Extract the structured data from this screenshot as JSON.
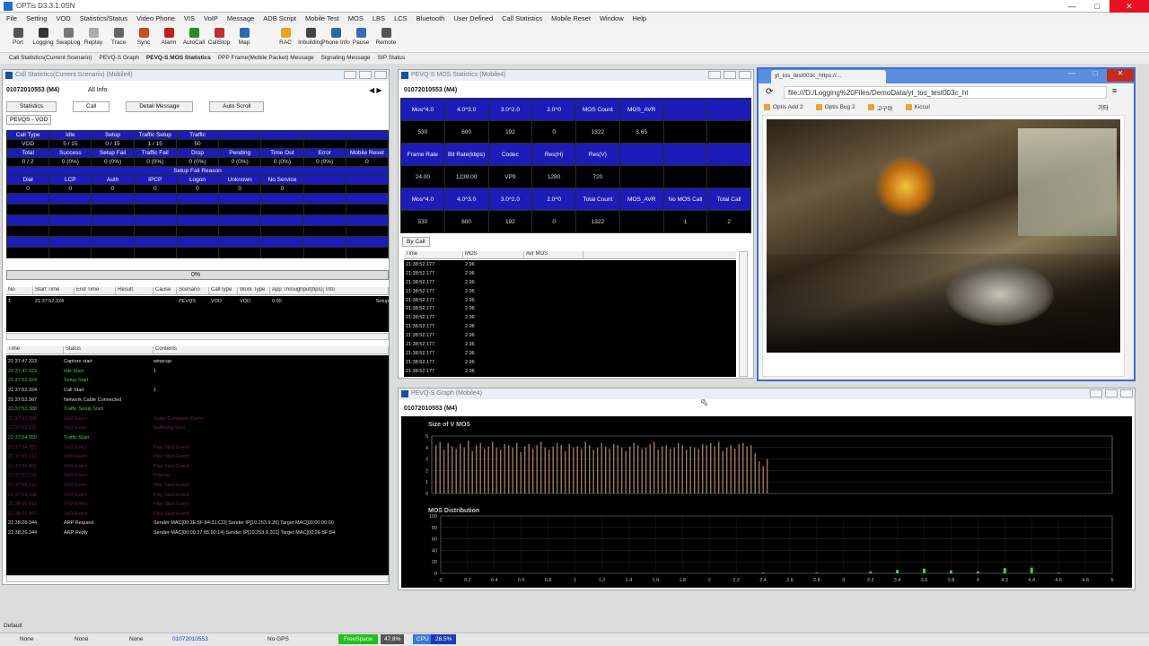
{
  "app": {
    "title": "OPTis D3.3.1.0SN"
  },
  "menu": [
    "File",
    "Setting",
    "VOD",
    "Statistics/Status",
    "Video Phone",
    "VIS",
    "VoIP",
    "Message",
    "ADB Script",
    "Mobile Test",
    "MOS",
    "LBS",
    "LCS",
    "Bluetooth",
    "User Defined",
    "Call Statistics",
    "Mobile Reset",
    "Window",
    "Help"
  ],
  "toolbar": [
    "Port",
    "Logging",
    "SwapLog",
    "Replay",
    "Trace",
    "Sync",
    "Alarm",
    "AutoCall",
    "CallStop",
    "Map",
    "RAC",
    "Inbuilding",
    "Phone Info",
    "Pause",
    "Remote"
  ],
  "tabs": [
    "Call Statistics(Current Scenario)",
    "PEVQ-S Graph",
    "PEVQ-S MOS Statistics",
    "PPP Frame(Mobile Packet) Message",
    "Signaling Message",
    "SIP Status"
  ],
  "call_stats": {
    "title": "Call Statistics(Current Scenario) (Mobile4)",
    "device": "01072010553 (M4)",
    "all_info": "All Info",
    "subtabs": [
      "Statistics",
      "Call",
      "Detail Message",
      "Auto Scroll"
    ],
    "pevq_tab": "PEVQS - VOD",
    "row1_hdr": [
      "Call Type",
      "Idle",
      "Setup",
      "Traffic Setup",
      "Traffic"
    ],
    "row1_val": [
      "VOD",
      "5 / 15",
      "0 / 15",
      "1 / 15",
      "50"
    ],
    "row2_hdr": [
      "Total",
      "Success",
      "Setup Fail",
      "Traffic Fail",
      "Drop",
      "Pending",
      "Time Out",
      "Error",
      "Mobile Reset"
    ],
    "row2_val": [
      "0 / 2",
      "0 (0%)",
      "0 (0%)",
      "0 (0%)",
      "0 (0%)",
      "0 (0%)",
      "0 (0%)",
      "0 (0%)",
      "0"
    ],
    "fail_title": "Setup Fail Reason",
    "row3_hdr": [
      "Dial",
      "LCP",
      "Auth",
      "IPCP",
      "Logon",
      "Unknown",
      "No Service"
    ],
    "row3_val": [
      "0",
      "0",
      "0",
      "0",
      "0",
      "0",
      "0"
    ],
    "progress": "0%",
    "list_cols": [
      "No",
      "Start Time",
      "End Time",
      "Result",
      "Cause",
      "Scenario",
      "CallType",
      "Work Type",
      "App Throughput(bps)",
      "Info"
    ],
    "list_row": [
      "1",
      "21:37:52.324",
      "",
      "",
      "",
      "PEVQS",
      "VOD",
      "VOD",
      "0.00",
      "",
      "Setup"
    ],
    "log_cols": [
      "Time",
      "Status",
      "Contents"
    ],
    "log": [
      {
        "t": "21:37:47.323",
        "s": "Capture start",
        "c": "winpcap",
        "k": "wh"
      },
      {
        "t": "21:37:47.323",
        "s": "Idle Start",
        "c": "1",
        "k": "gl"
      },
      {
        "t": "21:37:52.324",
        "s": "Setup Start",
        "c": "",
        "k": "gl"
      },
      {
        "t": "21:37:52.324",
        "s": "Call Start",
        "c": "1",
        "k": "wh"
      },
      {
        "t": "21:37:52.367",
        "s": "Network Cable Connected",
        "c": "",
        "k": "wh"
      },
      {
        "t": "21:37:52.388",
        "s": "Traffic Setup Start",
        "c": "",
        "k": "gl"
      },
      {
        "t": "21:37:52.398",
        "s": "VoD Event",
        "c": "Setup Complete Event",
        "k": "pk"
      },
      {
        "t": "21:37:53.115",
        "s": "VoD Event",
        "c": "Buffering Start",
        "k": "pk"
      },
      {
        "t": "21:37:54.050",
        "s": "Traffic Start",
        "c": "",
        "k": "gl"
      },
      {
        "t": "21:37:54.051",
        "s": "VoD Event",
        "c": "Play Start Event",
        "k": "pk"
      },
      {
        "t": "21:37:55.211",
        "s": "VoD Event",
        "c": "Play Start Event",
        "k": "pk"
      },
      {
        "t": "21:37:56.002",
        "s": "VoD Event",
        "c": "Play Start Event",
        "k": "pk"
      },
      {
        "t": "21:37:57.118",
        "s": "VoD Event",
        "c": "Playing",
        "k": "pk"
      },
      {
        "t": "21:37:58.221",
        "s": "VoD Event",
        "c": "Play Start Event",
        "k": "pk"
      },
      {
        "t": "21:37:59.338",
        "s": "VoD Event",
        "c": "Play Start Event",
        "k": "pk"
      },
      {
        "t": "21:38:00.412",
        "s": "VoD Event",
        "c": "Play Start Event",
        "k": "pk"
      },
      {
        "t": "21:38:01.507",
        "s": "VoD Event",
        "c": "Play Start Event",
        "k": "pk"
      },
      {
        "t": "21:38:26.344",
        "s": "ARP Request",
        "c": "Sender MAC[00:2E:5F:84:31:CD] Sender IP[10.253.9.26] Target MAC[00:00:00:00",
        "k": "wh"
      },
      {
        "t": "21:38:26.344",
        "s": "ARP Reply",
        "c": "Sender MAC[00:00:37:85:90:14] Sender IP[10.253.9.201] Target MAC[00:2E:5F:84",
        "k": "wh"
      }
    ]
  },
  "mos_stats": {
    "title": "PEVQ-S MOS Statistics (Mobile4)",
    "device": "01072010553 (M4)",
    "r1h": [
      "Mos^4.0",
      "4.0^3.0",
      "3.0^2.0",
      "2.0^0",
      "MOS Count",
      "MOS_AVR",
      "",
      ""
    ],
    "r1v": [
      "530",
      "600",
      "192",
      "0",
      "1322",
      "3.65",
      "",
      ""
    ],
    "r2h": [
      "Frame Rate",
      "Bit Rate(kbps)",
      "Codec",
      "Res(H)",
      "Res(V)",
      "",
      "",
      ""
    ],
    "r2v": [
      "24.00",
      "1239.00",
      "VP9",
      "1280",
      "720",
      "",
      "",
      ""
    ],
    "r3h": [
      "Mos^4.0",
      "4.0^3.0",
      "3.0^2.0",
      "2.0^0",
      "Total Count",
      "MOS_AVR",
      "No MOS Call",
      "Total Call"
    ],
    "r3v": [
      "530",
      "600",
      "192",
      "0",
      "1322",
      "",
      "1",
      "2"
    ],
    "bycall": "By Call",
    "cols": [
      "Time",
      "MOS",
      "Avr MOS"
    ],
    "rows": [
      [
        "21:38:52.177",
        "2.96"
      ],
      [
        "21:38:52.177",
        "2.96"
      ],
      [
        "21:38:52.177",
        "2.96"
      ],
      [
        "21:38:52.177",
        "2.96"
      ],
      [
        "21:38:52.177",
        "2.96"
      ],
      [
        "21:38:52.177",
        "2.96"
      ],
      [
        "21:38:52.177",
        "2.96"
      ],
      [
        "21:38:52.177",
        "2.96"
      ],
      [
        "21:38:52.177",
        "2.96"
      ],
      [
        "21:38:52.177",
        "2.96"
      ],
      [
        "21:38:52.177",
        "2.96"
      ],
      [
        "21:38:52.177",
        "2.96"
      ],
      [
        "21:38:52.177",
        "2.96"
      ]
    ]
  },
  "browser": {
    "tab": "yt_tos_test003c_https://...",
    "url": "file:///D:/Logging%20Files/DemoData/yt_tos_test003c_ht",
    "bookmarks": [
      "Optis Add 2",
      "Optis Bug 2",
      "고구마",
      "Kiccul"
    ],
    "other": "기타"
  },
  "graph": {
    "title": "PEVQ-S Graph (Mobile4)",
    "device": "01072010553 (M4)",
    "chart_data": [
      {
        "type": "bar",
        "title": "Size of V MOS",
        "ylim": [
          0,
          5
        ],
        "yticks": [
          "0",
          "1",
          "2",
          "3",
          "4",
          "5"
        ],
        "color": "#9b7a5a",
        "values": [
          4.2,
          4.5,
          3.8,
          4.4,
          4.1,
          3.9,
          4.3,
          4.0,
          4.6,
          3.7,
          4.2,
          4.4,
          3.9,
          4.1,
          4.5,
          4.0,
          3.8,
          4.3,
          4.2,
          4.0,
          4.4,
          3.6,
          4.1,
          4.3,
          3.9,
          4.2,
          4.5,
          4.0,
          3.8,
          4.1,
          4.4,
          4.2,
          3.7,
          4.3,
          4.0,
          4.1,
          3.9,
          4.5,
          4.2,
          3.8,
          4.0,
          4.4,
          4.1,
          3.9,
          4.3,
          4.2,
          4.0,
          3.7,
          4.1,
          4.4,
          4.2,
          3.9,
          4.0,
          4.3,
          4.5,
          3.8,
          4.1,
          4.2,
          3.9,
          4.0,
          4.4,
          4.2,
          3.8,
          4.1,
          4.0,
          3.9,
          4.3,
          4.2,
          4.4,
          4.1,
          4.5,
          3.7,
          4.0,
          4.2,
          3.9,
          4.3,
          4.4,
          4.1,
          4.2,
          3.5,
          2.8,
          2.4,
          3.0
        ]
      },
      {
        "type": "bar",
        "title": "MOS Distribution",
        "ylim": [
          0,
          100
        ],
        "yticks": [
          "0",
          "20",
          "40",
          "60",
          "80",
          "100"
        ],
        "x": [
          "0",
          "0.2",
          "0.4",
          "0.6",
          "0.8",
          "1",
          "1.2",
          "1.4",
          "1.6",
          "1.8",
          "2",
          "2.2",
          "2.4",
          "2.6",
          "2.8",
          "3",
          "3.2",
          "3.4",
          "3.6",
          "3.8",
          "4",
          "4.2",
          "4.4",
          "4.6",
          "4.8",
          "5"
        ],
        "values": [
          {
            "x": 3.2,
            "y": 3
          },
          {
            "x": 3.4,
            "y": 6
          },
          {
            "x": 3.6,
            "y": 8
          },
          {
            "x": 3.8,
            "y": 5
          },
          {
            "x": 4.0,
            "y": 3
          },
          {
            "x": 4.2,
            "y": 9
          },
          {
            "x": 4.4,
            "y": 10
          },
          {
            "x": 2.4,
            "y": 1
          },
          {
            "x": 2.8,
            "y": 1
          },
          {
            "x": 4.6,
            "y": 1
          }
        ]
      }
    ]
  },
  "status": {
    "mode": "Default",
    "f1": "None",
    "f2": "None",
    "f3": "None",
    "phone": "01072010553",
    "gps": "No GPS",
    "free": "FreeSpace",
    "freeval": "47.8%",
    "cpu": "CPU",
    "cpuval": "28.5%"
  }
}
